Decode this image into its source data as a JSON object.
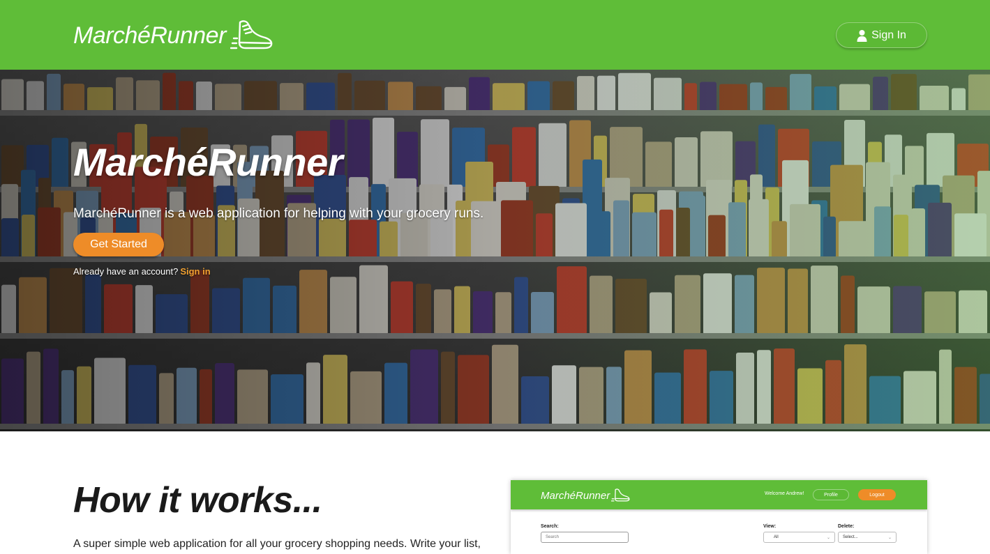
{
  "navbar": {
    "brand": "MarchéRunner",
    "signin_label": "Sign In",
    "color": "#5fbd38"
  },
  "hero": {
    "title": "MarchéRunner",
    "subtitle": "MarchéRunner is a web application for helping with your grocery runs.",
    "cta_label": "Get Started",
    "cta_color": "#ee8c28",
    "account_prompt": "Already have an account?",
    "account_link": "Sign in"
  },
  "how": {
    "title": "How it works...",
    "text": "A super simple web application for all your grocery shopping needs. Write your list,"
  },
  "preview": {
    "brand": "MarchéRunner",
    "welcome": "Welcome Andrew!",
    "profile_label": "Profile",
    "logout_label": "Logout",
    "search_label": "Search:",
    "search_placeholder": "Search",
    "view_label": "View:",
    "view_value": "All",
    "delete_label": "Delete:",
    "delete_value": "Select..."
  },
  "icons": {
    "brand_logo": "running-shoe-icon",
    "signin": "user-icon"
  }
}
